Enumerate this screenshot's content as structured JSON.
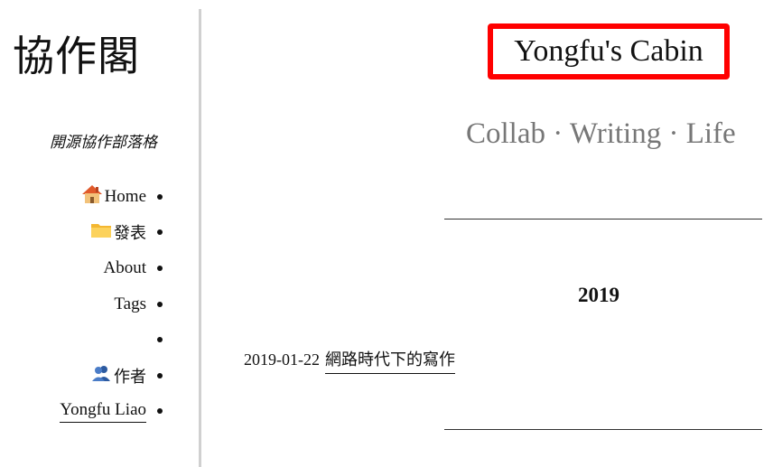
{
  "sidebar": {
    "logo": "協作閣",
    "tagline": "開源協作部落格",
    "nav": [
      {
        "label": "Home",
        "icon": "house-icon"
      },
      {
        "label": "發表",
        "icon": "folder-icon"
      },
      {
        "label": "About",
        "icon": ""
      },
      {
        "label": "Tags",
        "icon": ""
      },
      {
        "label": "",
        "icon": ""
      },
      {
        "label": "作者",
        "icon": "people-icon"
      },
      {
        "label": "Yongfu Liao",
        "icon": ""
      }
    ]
  },
  "main": {
    "site_title": "Yongfu's Cabin",
    "subtitle": "Collab · Writing · Life",
    "archive": {
      "year": "2019",
      "posts": [
        {
          "date": "2019-01-22",
          "title": "網路時代下的寫作"
        }
      ]
    }
  },
  "colors": {
    "highlight_border": "#ff0000",
    "subtitle": "#777777",
    "divider": "#d0d0d0"
  }
}
